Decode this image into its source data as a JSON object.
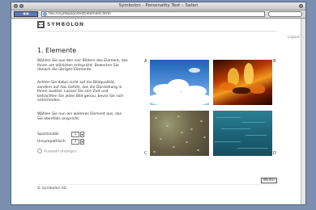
{
  "browser": {
    "window_title": "Symbolon - Personality Test – Safari",
    "back_label": "◀ ▶",
    "url": "file:///symbolon/test/element.html"
  },
  "page": {
    "logo_text": "SYMBOLON",
    "top_link": "Logout",
    "heading": "1. Elemente",
    "para1": "Wählen Sie aus den vier Bildern das Element, das Ihnen am stärksten entspricht. Bewerten Sie danach die übrigen Elemente.",
    "para2": "Achten Sie dabei nicht auf die Bildqualität, sondern auf das Gefühl, das die Darstellung in Ihnen auslöst. Lassen Sie sich Zeit und betrachten Sie jedes Bild genau, bevor Sie sich entscheiden.",
    "para3": "Wählen Sie nun ein weiteres Element aus, das Sie ebenfalls anspricht.",
    "field1_label": "Spontanität",
    "field1_value": "1",
    "field2_label": "Unsympathisch",
    "field2_value": "1",
    "hint": "Auswahl anzeigen",
    "corner_a": "A",
    "corner_b": "B",
    "corner_c": "C",
    "corner_d": "D",
    "next_button": "Weiter",
    "footer": "© Symbolon AG"
  },
  "images": [
    {
      "label": "Luft"
    },
    {
      "label": "Feuer"
    },
    {
      "label": "Erde"
    },
    {
      "label": "Wasser"
    }
  ]
}
